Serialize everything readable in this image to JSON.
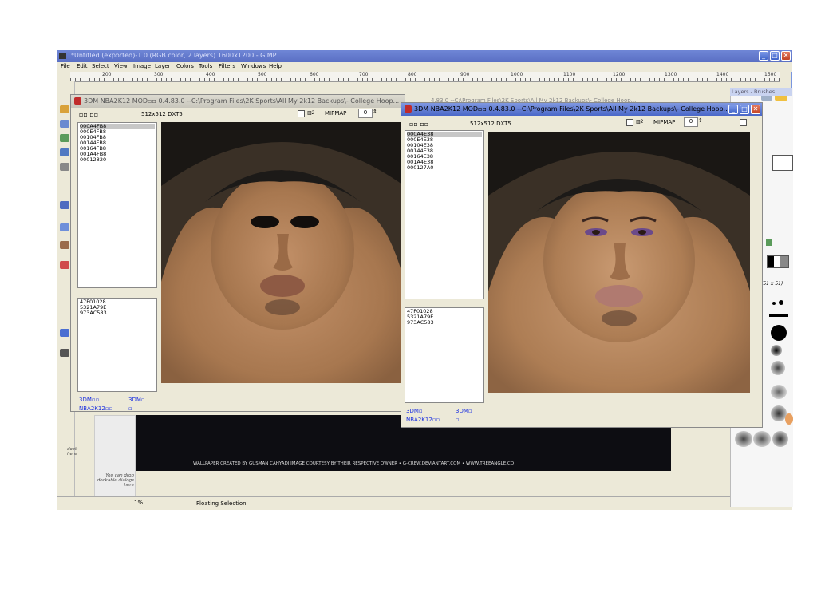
{
  "gimp": {
    "title": "*Untitled (exported)-1.0 (RGB color, 2 layers) 1600x1200 - GIMP",
    "menu": [
      "File",
      "Edit",
      "Select",
      "View",
      "Image",
      "Layer",
      "Colors",
      "Tools",
      "Filters",
      "Windows",
      "Help"
    ],
    "ruler_labels": [
      "200",
      "300",
      "400",
      "500",
      "600",
      "700",
      "800",
      "900",
      "1000",
      "1100",
      "1200",
      "1300",
      "1400",
      "1500"
    ],
    "status": "Floating Selection",
    "zoom": "1%",
    "dock_hint": "You can drop dockable dialogs here",
    "dock_hint_left": "dock here",
    "credit": "WALLPAPER CREATED BY GUSMAN CAHYADI IMAGE COURTESY BY THEIR RESPECTIVE OWNER • G-CREW.DEVIANTART.COM • WWW.TREEANGLE.CO",
    "right_dock_title": "Layers - Brushes",
    "brush_label": "(51 x 51)"
  },
  "window_left": {
    "title": "3DM NBA2K12 MOD▫▫ 0.4.83.0 --C:\\Program Files\\2K Sports\\All My 2k12 Backups\\- College Hoop...",
    "buttons": "▫▫  ▫▫",
    "format": "512x512 DXT5",
    "mipmap_label": "MIPMAP",
    "mipmap_value": "0",
    "top_list": [
      "000A4FB8",
      "000E4FB8",
      "00104FB8",
      "00144FB8",
      "00164FB8",
      "001A4FB8",
      "00012820"
    ],
    "bottom_list": [
      "47F01028",
      "5321A79E",
      "973AC583"
    ],
    "footer": [
      "3DM▫▫",
      "3DM▫",
      "NBA2K12▫▫",
      "▫"
    ]
  },
  "window_right": {
    "title": "3DM NBA2K12 MOD▫▫ 0.4.83.0 --C:\\Program Files\\2K Sports\\All My 2k12 Backups\\- College Hoop...",
    "behind_title": "4.83.0 --C:\\Program Files\\2K Sports\\All My 2k12 Backups\\- College Hoop...",
    "buttons": "▫▫  ▫▫",
    "format": "512x512 DXT5",
    "mipmap_label": "MIPMAP",
    "mipmap_value": "0",
    "top_list": [
      "000A4E38",
      "000E4E38",
      "00104E38",
      "00144E38",
      "00164E38",
      "001A4E38",
      "000127A0"
    ],
    "bottom_list": [
      "47F01028",
      "5321A79E",
      "973AC583"
    ],
    "footer": [
      "3DM▫",
      "3DM▫",
      "NBA2K12▫▫",
      "▫"
    ]
  },
  "colors": {
    "titlebar": "#5a6fc4",
    "skin": "#b07e55",
    "hair": "#1c1a18",
    "footer_link": "#1a2fe0"
  }
}
